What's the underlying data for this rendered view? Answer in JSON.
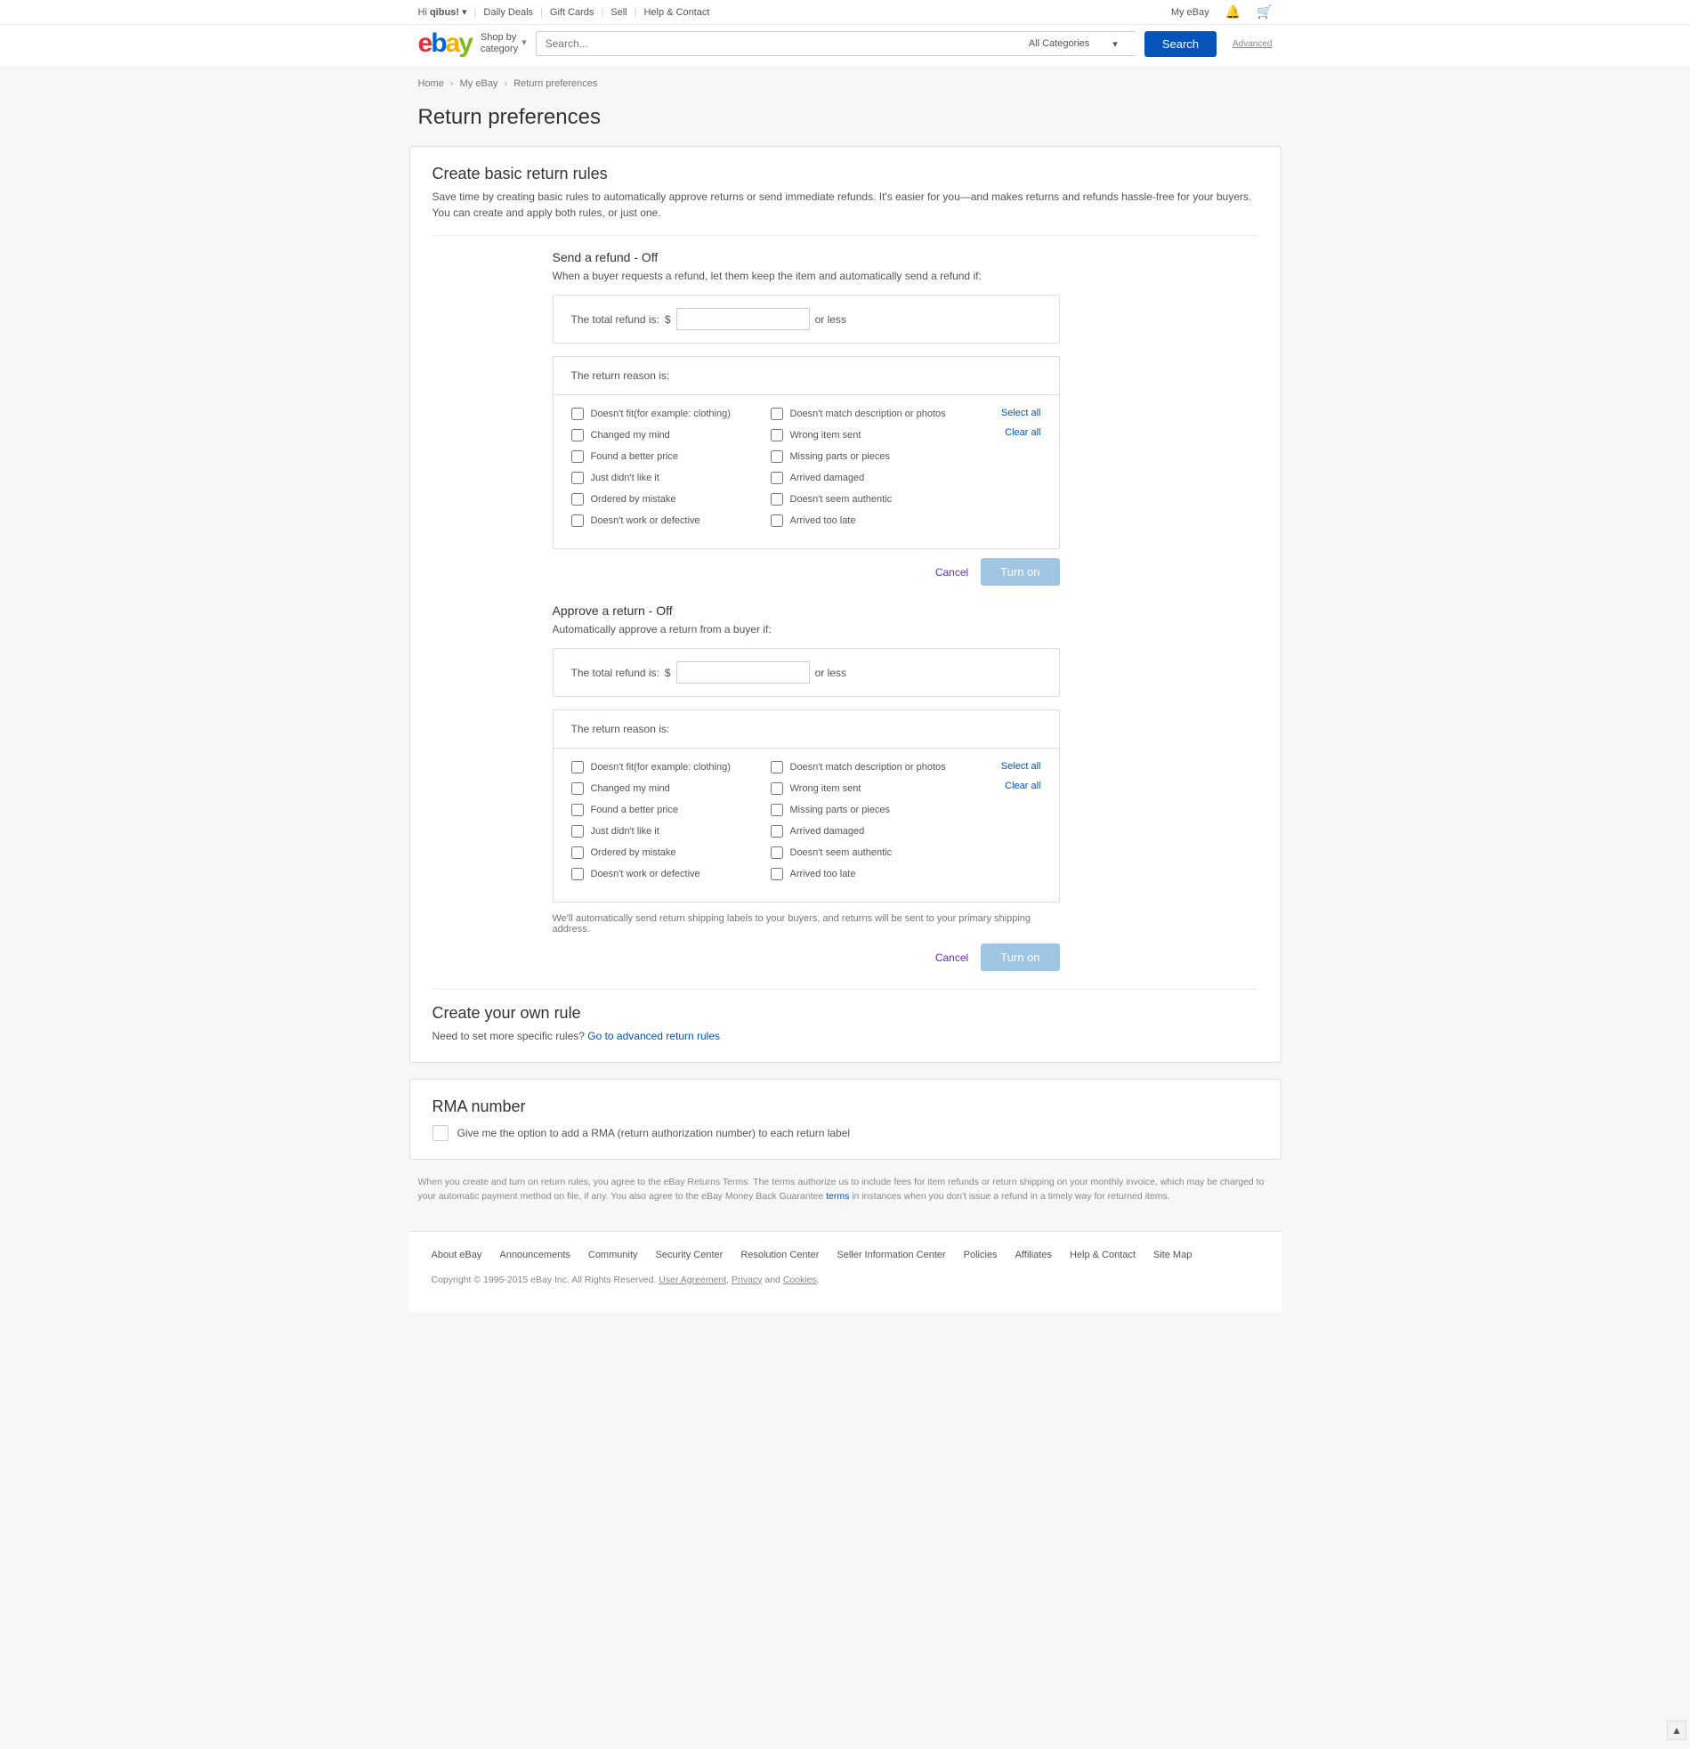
{
  "topBar": {
    "greeting": "Hi",
    "user": "qibus!",
    "links": [
      "Daily Deals",
      "Gift Cards",
      "Sell",
      "Help & Contact"
    ],
    "myEbay": "My eBay"
  },
  "header": {
    "shopBy": "Shop by\ncategory",
    "searchPlaceholder": "Search...",
    "catSelect": "All Categories",
    "searchBtn": "Search",
    "advanced": "Advanced"
  },
  "breadcrumb": [
    "Home",
    "My eBay",
    "Return preferences"
  ],
  "pageTitle": "Return preferences",
  "basicRules": {
    "title": "Create basic return rules",
    "desc": "Save time by creating basic rules to automatically approve returns or send immediate refunds. It's easier for you—and makes returns and refunds hassle-free for your buyers. You can create and apply both rules, or just one."
  },
  "refund": {
    "title": "Send a refund  - Off",
    "sub": "When a buyer requests a refund, let them keep the item and automatically send a refund if:",
    "totalLabel": "The total refund is:",
    "currency": "$",
    "orLess": "or less",
    "reasonHeader": "The return reason is:"
  },
  "approve": {
    "title": "Approve a return  - Off",
    "sub": "Automatically approve a return from a buyer if:",
    "note": "We'll automatically send return shipping labels to your buyers, and returns will be sent to your primary shipping address."
  },
  "reasonsCol1": [
    "Doesn't fit(for example: clothing)",
    "Changed my mind",
    "Found a better price",
    "Just didn't like it",
    "Ordered by mistake",
    "Doesn't work or defective"
  ],
  "reasonsCol2": [
    "Doesn't match description or photos",
    "Wrong item sent",
    "Missing parts or pieces",
    "Arrived damaged",
    "Doesn't seem authentic",
    "Arrived too late"
  ],
  "selectAll": "Select all",
  "clearAll": "Clear all",
  "cancel": "Cancel",
  "turnOn": "Turn on",
  "ownRule": {
    "title": "Create your own rule",
    "desc": "Need to set more specific rules? ",
    "link": "Go to advanced return rules"
  },
  "rma": {
    "title": "RMA number",
    "label": "Give me the option to add a RMA (return authorization number) to each return label"
  },
  "legal": {
    "part1": "When you create and turn on return rules, you agree to the eBay Returns Terms. The terms authorize us to include fees for item refunds or return shipping on your monthly invoice, which may be charged to your automatic payment method on file, if any. You also agree to the eBay Money Back Guarantee ",
    "termsLink": "terms",
    "part2": " in instances when you don't issue a refund in a timely way for returned items."
  },
  "footer": {
    "links": [
      "About eBay",
      "Announcements",
      "Community",
      "Security Center",
      "Resolution Center",
      "Seller Information Center",
      "Policies",
      "Affiliates",
      "Help & Contact",
      "Site Map"
    ],
    "copyright": "Copyright © 1995-2015 eBay Inc. All Rights Reserved. ",
    "ua": "User Agreement",
    "privacy": "Privacy",
    "cookies": "Cookies",
    "and": " and "
  }
}
